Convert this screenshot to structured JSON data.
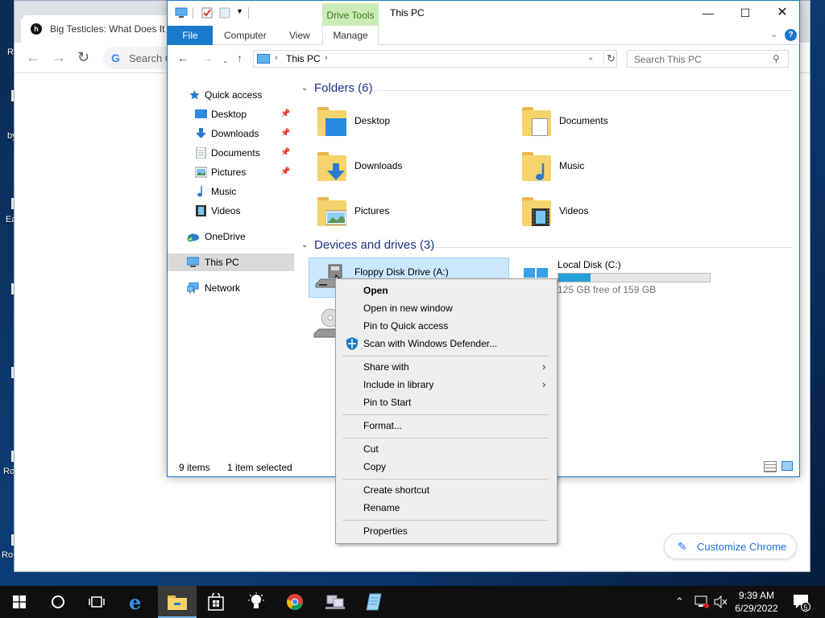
{
  "chrome": {
    "tab_title": "Big Testicles: What Does It M",
    "search_placeholder": "Search G",
    "customize_label": "Customize Chrome"
  },
  "desktop": {
    "fragments": [
      "Re",
      "by",
      "Ea",
      "Ro",
      "Ro"
    ]
  },
  "explorer": {
    "contextual_tab": "Drive Tools",
    "title": "This PC",
    "ribbon_tabs": [
      "File",
      "Computer",
      "View",
      "Manage"
    ],
    "address": {
      "crumb": "This PC"
    },
    "search_placeholder": "Search This PC",
    "nav": {
      "quick_access": "Quick access",
      "items": [
        {
          "label": "Desktop",
          "pinned": true
        },
        {
          "label": "Downloads",
          "pinned": true
        },
        {
          "label": "Documents",
          "pinned": true
        },
        {
          "label": "Pictures",
          "pinned": true
        },
        {
          "label": "Music",
          "pinned": false
        },
        {
          "label": "Videos",
          "pinned": false
        }
      ],
      "onedrive": "OneDrive",
      "this_pc": "This PC",
      "network": "Network"
    },
    "folders_header": "Folders (6)",
    "folders": [
      "Desktop",
      "Documents",
      "Downloads",
      "Music",
      "Pictures",
      "Videos"
    ],
    "devices_header": "Devices and drives (3)",
    "drives": [
      {
        "label": "Floppy Disk Drive (A:)"
      },
      {
        "label": "Local Disk (C:)",
        "free_text": "125 GB free of 159 GB",
        "used_fraction": 0.214
      }
    ],
    "status": {
      "items": "9 items",
      "selected": "1 item selected"
    }
  },
  "context_menu": {
    "open": "Open",
    "open_new_window": "Open in new window",
    "pin_quick_access": "Pin to Quick access",
    "scan_defender": "Scan with Windows Defender...",
    "share_with": "Share with",
    "include_library": "Include in library",
    "pin_start": "Pin to Start",
    "format": "Format...",
    "cut": "Cut",
    "copy": "Copy",
    "create_shortcut": "Create shortcut",
    "rename": "Rename",
    "properties": "Properties"
  },
  "taskbar": {
    "time": "9:39 AM",
    "date": "6/29/2022",
    "notification_count": "5"
  },
  "colors": {
    "accent": "#1979ca",
    "selection": "#cce8ff",
    "header_text": "#1e3287",
    "drive_bar": "#26a0da"
  }
}
